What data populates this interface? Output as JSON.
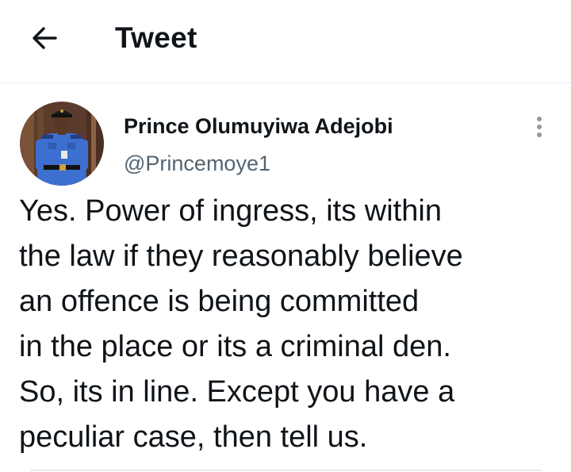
{
  "header": {
    "title": "Tweet",
    "back_icon": "arrow-left-icon"
  },
  "tweet": {
    "author_name": "Prince Olumuyiwa Adejobi",
    "author_handle": "@Princemoye1",
    "more_icon": "more-vertical-icon",
    "text_lines": [
      "Yes. Power of ingress, its within",
      "the law if they reasonably believe",
      "an offence is being committed",
      "in the place or its a criminal den.",
      "So, its in line. Except you have a",
      "peculiar case, then tell us."
    ]
  },
  "colors": {
    "text_primary": "#0f1419",
    "text_secondary": "#536471",
    "divider": "#e6e9ec"
  }
}
